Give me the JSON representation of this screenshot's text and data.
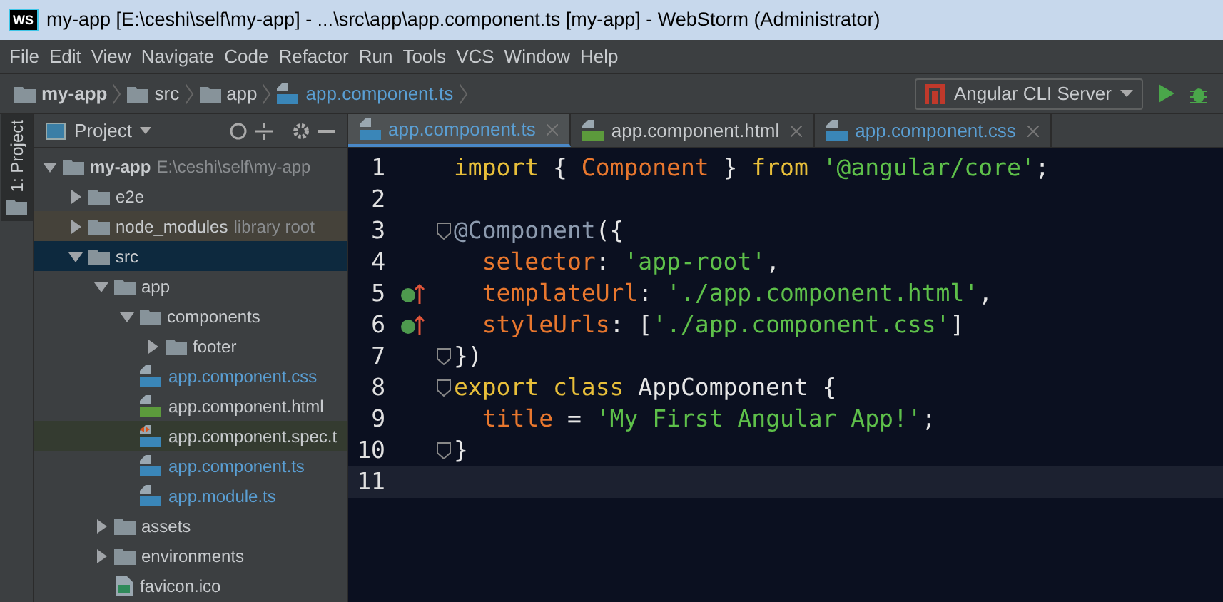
{
  "window": {
    "title": "my-app [E:\\ceshi\\self\\my-app] - ...\\src\\app\\app.component.ts [my-app] - WebStorm (Administrator)",
    "logo": "WS"
  },
  "menu": [
    {
      "label": "File"
    },
    {
      "label": "Edit"
    },
    {
      "label": "View"
    },
    {
      "label": "Navigate"
    },
    {
      "label": "Code"
    },
    {
      "label": "Refactor"
    },
    {
      "label": "Run"
    },
    {
      "label": "Tools"
    },
    {
      "label": "VCS"
    },
    {
      "label": "Window"
    },
    {
      "label": "Help"
    }
  ],
  "breadcrumbs": [
    {
      "label": "my-app",
      "kind": "folder"
    },
    {
      "label": "src",
      "kind": "folder"
    },
    {
      "label": "app",
      "kind": "folder"
    },
    {
      "label": "app.component.ts",
      "kind": "ts"
    }
  ],
  "run_config": {
    "label": "Angular CLI Server"
  },
  "side_stripe": {
    "label": "1: Project"
  },
  "project_panel": {
    "title": "Project"
  },
  "tree": [
    {
      "label": "my-app",
      "hint": "E:\\ceshi\\self\\my-app",
      "kind": "folder",
      "expanded": true,
      "selected": false,
      "modified": false,
      "children": [
        {
          "label": "e2e",
          "kind": "folder",
          "expanded": false,
          "selected": false,
          "modified": false
        },
        {
          "label": "node_modules",
          "hint": "library root",
          "kind": "library",
          "expanded": false,
          "selected": false,
          "modified": false
        },
        {
          "label": "src",
          "kind": "folder",
          "expanded": true,
          "selected": true,
          "modified": false,
          "children": [
            {
              "label": "app",
              "kind": "folder",
              "expanded": true,
              "selected": false,
              "modified": false,
              "children": [
                {
                  "label": "components",
                  "kind": "folder",
                  "expanded": true,
                  "selected": false,
                  "modified": false,
                  "children": [
                    {
                      "label": "footer",
                      "kind": "folder",
                      "expanded": false,
                      "selected": false,
                      "modified": false
                    }
                  ]
                },
                {
                  "label": "app.component.css",
                  "kind": "css",
                  "selected": false,
                  "modified": true
                },
                {
                  "label": "app.component.html",
                  "kind": "html",
                  "selected": false,
                  "modified": false
                },
                {
                  "label": "app.component.spec.t",
                  "kind": "spec",
                  "selected": false,
                  "modified": false
                },
                {
                  "label": "app.component.ts",
                  "kind": "ts",
                  "selected": false,
                  "modified": true
                },
                {
                  "label": "app.module.ts",
                  "kind": "ts",
                  "selected": false,
                  "modified": true
                }
              ]
            },
            {
              "label": "assets",
              "kind": "folder",
              "expanded": false,
              "selected": false,
              "modified": false
            },
            {
              "label": "environments",
              "kind": "folder",
              "expanded": false,
              "selected": false,
              "modified": false
            },
            {
              "label": "favicon.ico",
              "kind": "image",
              "selected": false,
              "modified": false
            }
          ]
        }
      ]
    }
  ],
  "tabs": [
    {
      "label": "app.component.ts",
      "kind": "ts",
      "selected": true,
      "modified": true
    },
    {
      "label": "app.component.html",
      "kind": "html",
      "selected": false,
      "modified": false
    },
    {
      "label": "app.component.css",
      "kind": "css",
      "selected": false,
      "modified": true
    }
  ],
  "code_lines": [
    {
      "number": "1",
      "kind": "plain",
      "current": false,
      "tokens": [
        {
          "text": "import",
          "kind": "keyword"
        },
        {
          "text": " { ",
          "kind": "plain"
        },
        {
          "text": "Component",
          "kind": "name"
        },
        {
          "text": " } ",
          "kind": "plain"
        },
        {
          "text": "from",
          "kind": "keyword"
        },
        {
          "text": " '@angular/core'",
          "kind": "string"
        },
        {
          "text": ";",
          "kind": "plain"
        }
      ]
    },
    {
      "number": "2",
      "kind": "plain",
      "current": false
    },
    {
      "number": "3",
      "kind": "fold",
      "current": false,
      "tokens": [
        {
          "text": "@Component",
          "kind": "decorator"
        },
        {
          "text": "({",
          "kind": "plain"
        }
      ]
    },
    {
      "number": "4",
      "kind": "plain",
      "current": false,
      "tokens": [
        {
          "text": "  selector",
          "kind": "name"
        },
        {
          "text": ": ",
          "kind": "plain"
        },
        {
          "text": "'app-root'",
          "kind": "string"
        },
        {
          "text": ",",
          "kind": "plain"
        }
      ]
    },
    {
      "number": "5",
      "kind": "implements",
      "current": false,
      "tokens": [
        {
          "text": "  templateUrl",
          "kind": "name"
        },
        {
          "text": ": ",
          "kind": "plain"
        },
        {
          "text": "'./app.component.html'",
          "kind": "string"
        },
        {
          "text": ",",
          "kind": "plain"
        }
      ]
    },
    {
      "number": "6",
      "kind": "implements",
      "current": false,
      "tokens": [
        {
          "text": "  styleUrls",
          "kind": "name"
        },
        {
          "text": ": [",
          "kind": "plain"
        },
        {
          "text": "'./app.component.css'",
          "kind": "string"
        },
        {
          "text": "]",
          "kind": "plain"
        }
      ]
    },
    {
      "number": "7",
      "kind": "fold",
      "current": false,
      "tokens": [
        {
          "text": "})",
          "kind": "plain"
        }
      ]
    },
    {
      "number": "8",
      "kind": "fold",
      "current": false,
      "tokens": [
        {
          "text": "export class",
          "kind": "keyword"
        },
        {
          "text": " AppComponent {",
          "kind": "plain"
        }
      ]
    },
    {
      "number": "9",
      "kind": "plain",
      "current": false,
      "tokens": [
        {
          "text": "  title",
          "kind": "name"
        },
        {
          "text": " = ",
          "kind": "plain"
        },
        {
          "text": "'My First Angular App!'",
          "kind": "string"
        },
        {
          "text": ";",
          "kind": "plain"
        }
      ]
    },
    {
      "number": "10",
      "kind": "fold",
      "current": false,
      "tokens": [
        {
          "text": "}",
          "kind": "plain"
        }
      ]
    },
    {
      "number": "11",
      "kind": "plain",
      "current": true
    }
  ]
}
